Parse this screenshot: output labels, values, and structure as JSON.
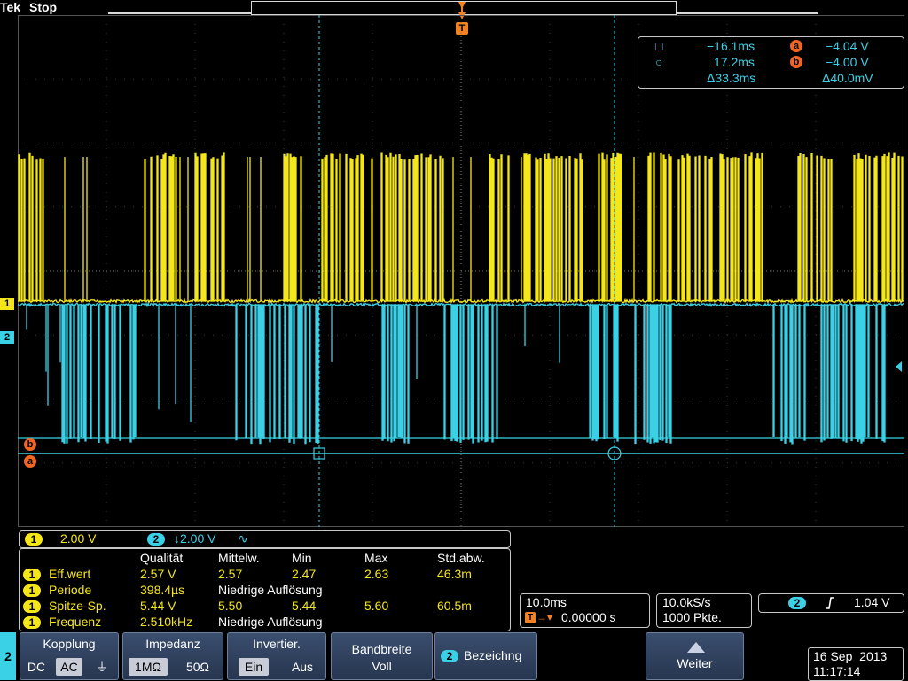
{
  "header": {
    "brand": "Tek",
    "run_state": "Stop"
  },
  "trigger_marker": "T",
  "cursors": {
    "rows": [
      {
        "shape": "□",
        "time": "−16.1ms",
        "ref": "a",
        "volt": "−4.04 V"
      },
      {
        "shape": "○",
        "time": "17.2ms",
        "ref": "b",
        "volt": "−4.00 V"
      },
      {
        "shape": "",
        "time": "Δ33.3ms",
        "ref": "",
        "volt": "Δ40.0mV"
      }
    ]
  },
  "channel_markers": {
    "ch1": "1",
    "ch2": "2",
    "ref_a": "a",
    "ref_b": "b"
  },
  "scale": {
    "ch1_num": "1",
    "ch1_value": "2.00 V",
    "ch2_num": "2",
    "ch2_value": "↓2.00 V",
    "ch2_bw": "∿"
  },
  "measurements": {
    "headers": [
      "Qualität",
      "Mittelw.",
      "Min",
      "Max",
      "Std.abw."
    ],
    "rows": [
      {
        "ch": "1",
        "name": "Eff.wert",
        "value": "2.57 V",
        "mean": "2.57",
        "min": "2.47",
        "max": "2.63",
        "std": "46.3m",
        "note": ""
      },
      {
        "ch": "1",
        "name": "Periode",
        "value": "398.4µs",
        "mean": "",
        "min": "",
        "max": "",
        "std": "",
        "note": "Niedrige Auflösung"
      },
      {
        "ch": "1",
        "name": "Spitze-Sp.",
        "value": "5.44 V",
        "mean": "5.50",
        "min": "5.44",
        "max": "5.60",
        "std": "60.5m",
        "note": ""
      },
      {
        "ch": "1",
        "name": "Frequenz",
        "value": "2.510kHz",
        "mean": "",
        "min": "",
        "max": "",
        "std": "",
        "note": "Niedrige Auflösung"
      }
    ]
  },
  "horizontal": {
    "scale": "10.0ms",
    "trigger_icon": "T",
    "delay": "0.00000 s"
  },
  "acquisition": {
    "rate": "10.0kS/s",
    "points": "1000 Pkte."
  },
  "trigger": {
    "channel": "2",
    "slope_icon": "rising-edge",
    "level": "1.04 V"
  },
  "menu": {
    "channel": "2",
    "kopplung": {
      "title": "Kopplung",
      "options": [
        "DC",
        "AC",
        "⏚"
      ],
      "selected": "AC"
    },
    "impedanz": {
      "title": "Impedanz",
      "options": [
        "1MΩ",
        "50Ω"
      ],
      "selected": "1MΩ"
    },
    "invertier": {
      "title": "Invertier.",
      "options": [
        "Ein",
        "Aus"
      ],
      "selected": "Ein"
    },
    "bandbreite": {
      "title": "Bandbreite",
      "value": "Voll"
    },
    "bezeichnung": {
      "ch": "2",
      "title": "Bezeichng"
    },
    "weiter": {
      "title": "Weiter"
    }
  },
  "datetime": {
    "date": "16 Sep  2013",
    "time": "11:17:14"
  },
  "colors": {
    "ch1": "#f5e61a",
    "ch2": "#3ad1e6",
    "ref": "#f26522",
    "trigger": "#f58220"
  }
}
